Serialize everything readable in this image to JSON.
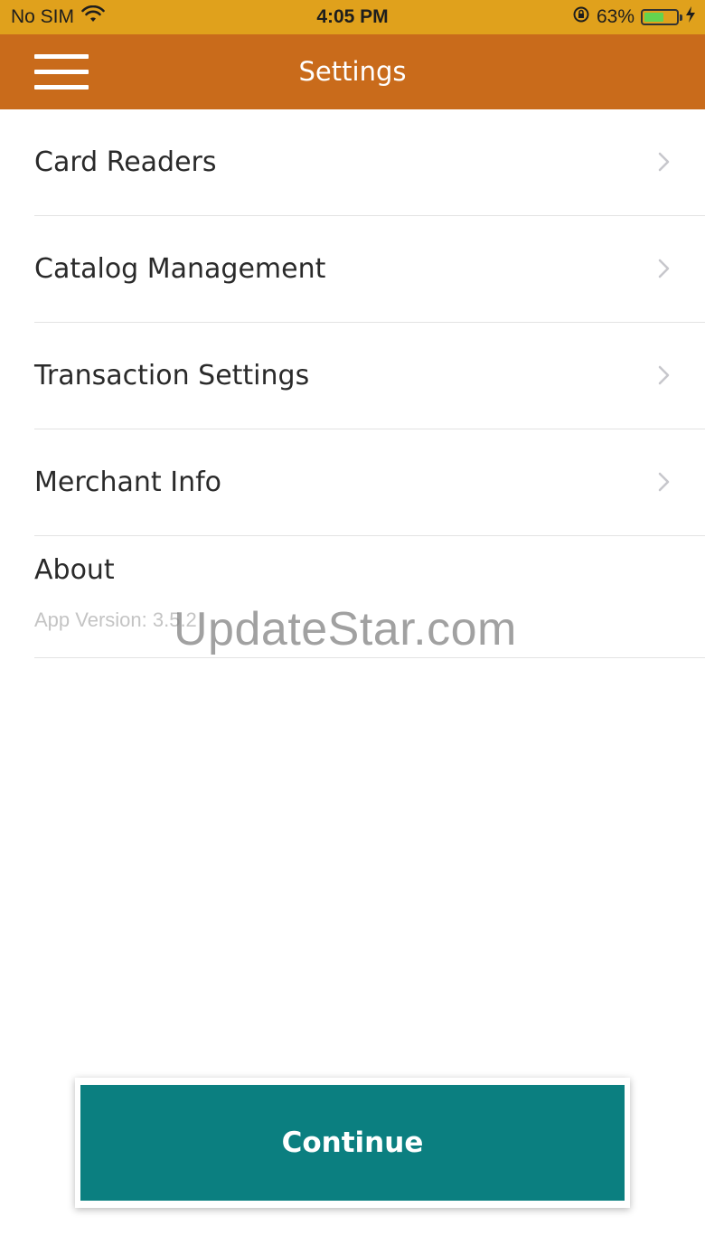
{
  "status_bar": {
    "carrier": "No SIM",
    "time": "4:05 PM",
    "battery_percent": "63%",
    "battery_level": 0.63,
    "icons": [
      "wifi-icon",
      "orientation-lock-icon",
      "battery-icon",
      "charging-icon"
    ]
  },
  "nav": {
    "title": "Settings",
    "menu_icon": "hamburger-menu-icon",
    "color": "#c96b1b"
  },
  "settings": {
    "items": [
      {
        "label": "Card Readers"
      },
      {
        "label": "Catalog Management"
      },
      {
        "label": "Transaction Settings"
      },
      {
        "label": "Merchant Info"
      }
    ],
    "about": {
      "title": "About",
      "version": "App Version: 3.5.2"
    }
  },
  "watermark": "UpdateStar.com",
  "footer": {
    "continue_label": "Continue",
    "color": "#0b7f80"
  }
}
